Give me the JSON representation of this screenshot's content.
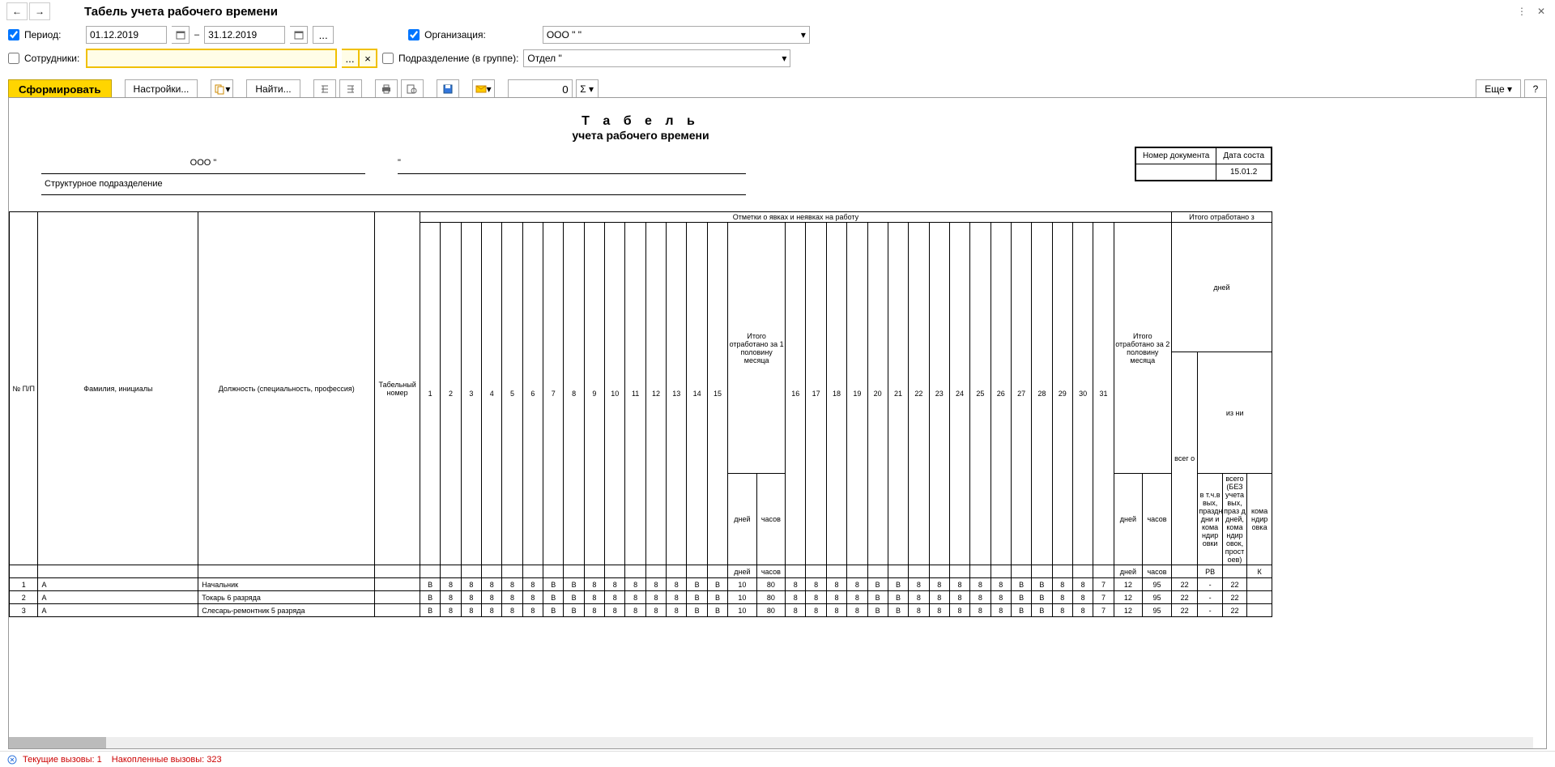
{
  "title": "Табель учета рабочего времени",
  "filters": {
    "period_label": "Период:",
    "date_from": "01.12.2019",
    "date_to": "31.12.2019",
    "dash": "–",
    "org_label": "Организация:",
    "org_value": "ООО       \"                       \"",
    "emp_label": "Сотрудники:",
    "subdiv_label": "Подразделение (в группе):",
    "subdiv_value": "Отдел       \""
  },
  "toolbar": {
    "generate": "Сформировать",
    "settings": "Настройки...",
    "find": "Найти...",
    "num_value": "0",
    "more": "Еще",
    "help": "?"
  },
  "report": {
    "title": "Т а б е л ь",
    "subtitle": "учета рабочего времени",
    "org_text": "ООО \"",
    "quote": "\"",
    "struct_label": "Структурное подразделение",
    "doc_num_label": "Номер документа",
    "doc_date_label": "Дата соста",
    "doc_date": "15.01.2"
  },
  "headers": {
    "marks": "Отметки о явках и неявках на работу",
    "total_worked": "Итого отработано з",
    "days": "дней",
    "num": "№ П/П",
    "name": "Фамилия, инициалы",
    "position": "Должность (специальность, профессия)",
    "tabnum": "Табельный номер",
    "half1": "Итого отработано за 1 половину месяца",
    "half2": "Итого отработано за 2 половину месяца",
    "vsego": "всег о",
    "izn": "из ни",
    "col_ext1": "в т.ч.в вых, праздн дни и кома ндир овки",
    "col_ext2": "всего (БЕЗ учета вых, праз д дней, кома ндир овок, прост оев)",
    "col_ext3": "кома ндир овка",
    "sub_days": "дней",
    "sub_hours": "часов",
    "rv": "РВ",
    "k": "К",
    "day_nums": [
      "1",
      "2",
      "3",
      "4",
      "5",
      "6",
      "7",
      "8",
      "9",
      "10",
      "11",
      "12",
      "13",
      "14",
      "15",
      "16",
      "17",
      "18",
      "19",
      "20",
      "21",
      "22",
      "23",
      "24",
      "25",
      "26",
      "27",
      "28",
      "29",
      "30",
      "31"
    ]
  },
  "rows": [
    {
      "n": "1",
      "name": "А",
      "pos": "Начальник",
      "tab": "",
      "days": [
        "В",
        "8",
        "8",
        "8",
        "8",
        "8",
        "В",
        "В",
        "8",
        "8",
        "8",
        "8",
        "8",
        "В",
        "В"
      ],
      "h1d": "10",
      "h1h": "80",
      "days2": [
        "8",
        "8",
        "8",
        "8",
        "В",
        "В",
        "8",
        "8",
        "8",
        "8",
        "8",
        "В",
        "В",
        "8",
        "8",
        "7"
      ],
      "h2d": "12",
      "h2h": "95",
      "tot": "22",
      "e1": "-",
      "e2": "22"
    },
    {
      "n": "2",
      "name": "А",
      "pos": "Токарь 6 разряда",
      "tab": "",
      "days": [
        "В",
        "8",
        "8",
        "8",
        "8",
        "8",
        "В",
        "В",
        "8",
        "8",
        "8",
        "8",
        "8",
        "В",
        "В"
      ],
      "h1d": "10",
      "h1h": "80",
      "days2": [
        "8",
        "8",
        "8",
        "8",
        "В",
        "В",
        "8",
        "8",
        "8",
        "8",
        "8",
        "В",
        "В",
        "8",
        "8",
        "7"
      ],
      "h2d": "12",
      "h2h": "95",
      "tot": "22",
      "e1": "-",
      "e2": "22"
    },
    {
      "n": "3",
      "name": "А",
      "pos": "Слесарь-ремонтник 5 разряда",
      "tab": "",
      "days": [
        "В",
        "8",
        "8",
        "8",
        "8",
        "8",
        "В",
        "В",
        "8",
        "8",
        "8",
        "8",
        "8",
        "В",
        "В"
      ],
      "h1d": "10",
      "h1h": "80",
      "days2": [
        "8",
        "8",
        "8",
        "8",
        "В",
        "В",
        "8",
        "8",
        "8",
        "8",
        "8",
        "В",
        "В",
        "8",
        "8",
        "7"
      ],
      "h2d": "12",
      "h2h": "95",
      "tot": "22",
      "e1": "-",
      "e2": "22"
    }
  ],
  "status": {
    "current": "Текущие вызовы: 1",
    "accum": "Накопленные вызовы: 323"
  }
}
